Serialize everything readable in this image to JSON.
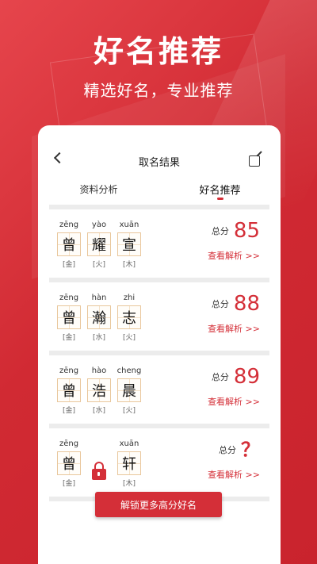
{
  "banner": {
    "headline": "好名推荐",
    "subline": "精选好名，专业推荐"
  },
  "header": {
    "title": "取名结果"
  },
  "tabs": [
    {
      "label": "资料分析"
    },
    {
      "label": "好名推荐"
    }
  ],
  "results": [
    {
      "chars": [
        {
          "pinyin": "zēng",
          "char": "曾",
          "element": "[金]"
        },
        {
          "pinyin": "yào",
          "char": "耀",
          "element": "[火]"
        },
        {
          "pinyin": "xuān",
          "char": "宣",
          "element": "[木]"
        }
      ],
      "score_label": "总分",
      "score": "85",
      "detail": "查看解析 >>"
    },
    {
      "chars": [
        {
          "pinyin": "zēng",
          "char": "曾",
          "element": "[金]"
        },
        {
          "pinyin": "hàn",
          "char": "瀚",
          "element": "[水]"
        },
        {
          "pinyin": "zhi",
          "char": "志",
          "element": "[火]"
        }
      ],
      "score_label": "总分",
      "score": "88",
      "detail": "查看解析 >>"
    },
    {
      "chars": [
        {
          "pinyin": "zēng",
          "char": "曾",
          "element": "[金]"
        },
        {
          "pinyin": "hào",
          "char": "浩",
          "element": "[水]"
        },
        {
          "pinyin": "cheng",
          "char": "晨",
          "element": "[火]"
        }
      ],
      "score_label": "总分",
      "score": "89",
      "detail": "查看解析 >>"
    },
    {
      "chars": [
        {
          "pinyin": "zēng",
          "char": "曾",
          "element": "[金]"
        },
        {
          "pinyin": "xuān",
          "char": "轩",
          "element": "[木]"
        }
      ],
      "score_label": "总分",
      "score": "？",
      "detail": "查看解析 >>"
    }
  ],
  "unlock_button": "解锁更多高分好名",
  "colors": {
    "accent": "#d42f38",
    "grid": "#e9c79c"
  }
}
